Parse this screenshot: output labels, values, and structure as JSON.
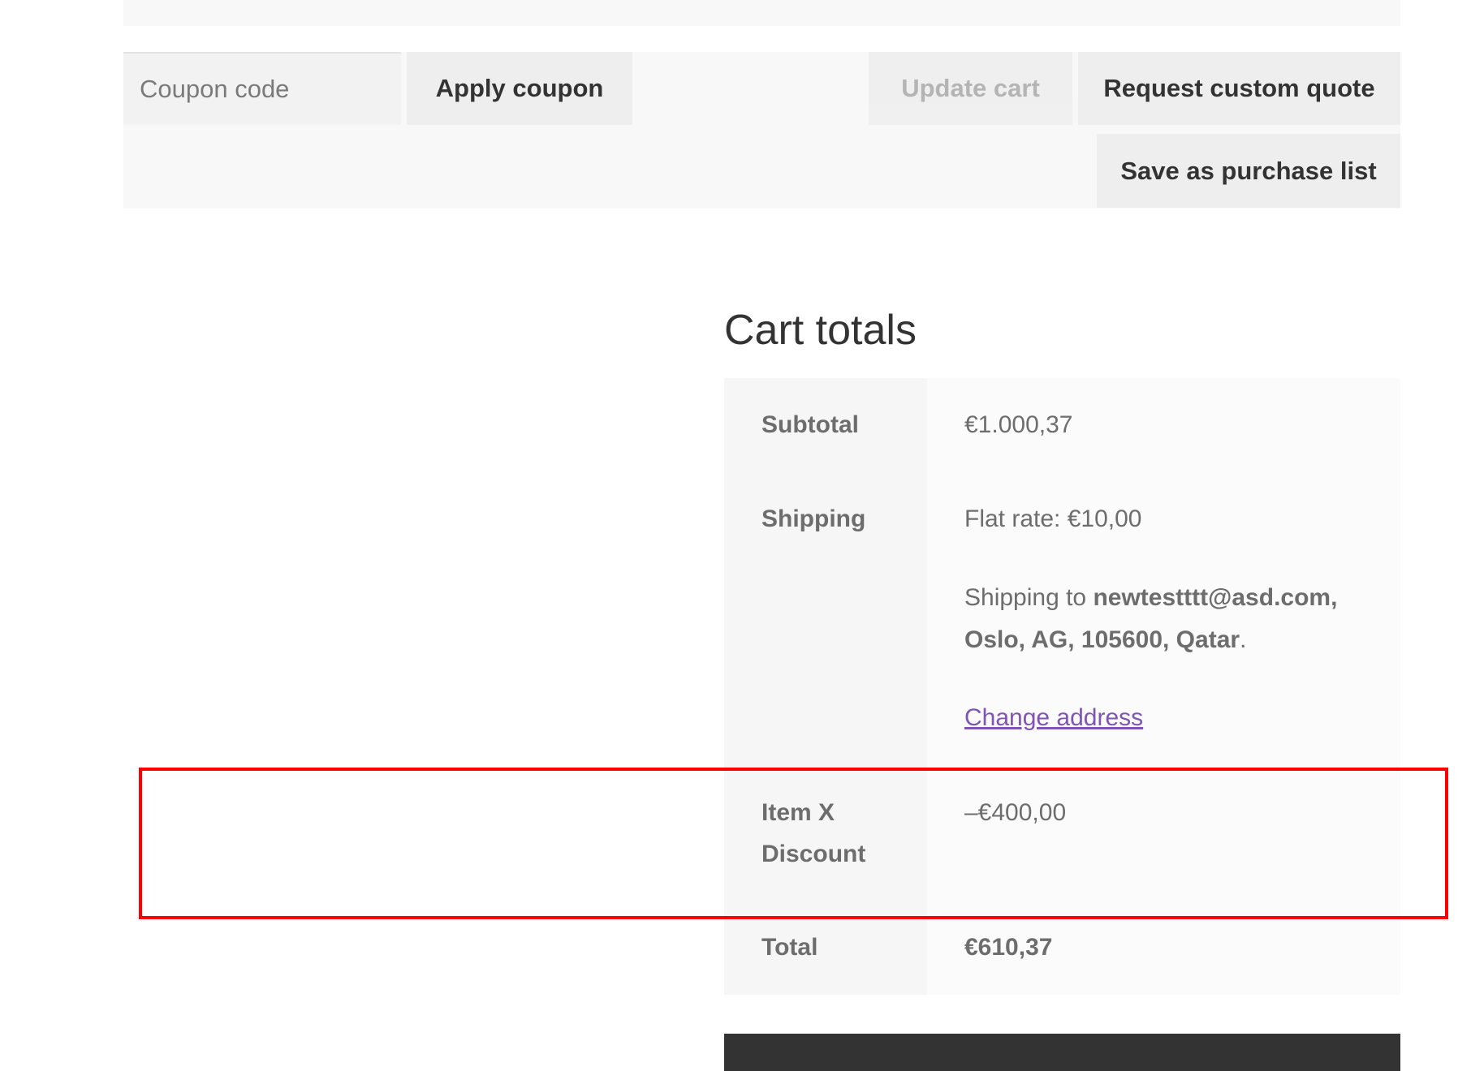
{
  "actions": {
    "coupon_placeholder": "Coupon code",
    "apply_coupon_label": "Apply coupon",
    "update_cart_label": "Update cart",
    "request_quote_label": "Request custom quote",
    "save_purchase_list_label": "Save as purchase list"
  },
  "cart_totals": {
    "title": "Cart totals",
    "rows": {
      "subtotal": {
        "label": "Subtotal",
        "value": "€1.000,37"
      },
      "shipping": {
        "label": "Shipping",
        "value": "Flat rate: €10,00",
        "destination_prefix": "Shipping to ",
        "destination_address": "newtestttt@asd.com, Oslo, AG, 105600, Qatar",
        "destination_suffix": ".",
        "change_address_label": "Change address"
      },
      "discount": {
        "label": "Item X Discount",
        "value": "–€400,00"
      },
      "total": {
        "label": "Total",
        "value": "€610,37"
      }
    }
  },
  "colors": {
    "highlight_border": "#ff0000",
    "link": "#7f54b3",
    "checkout_bar": "#333333"
  }
}
